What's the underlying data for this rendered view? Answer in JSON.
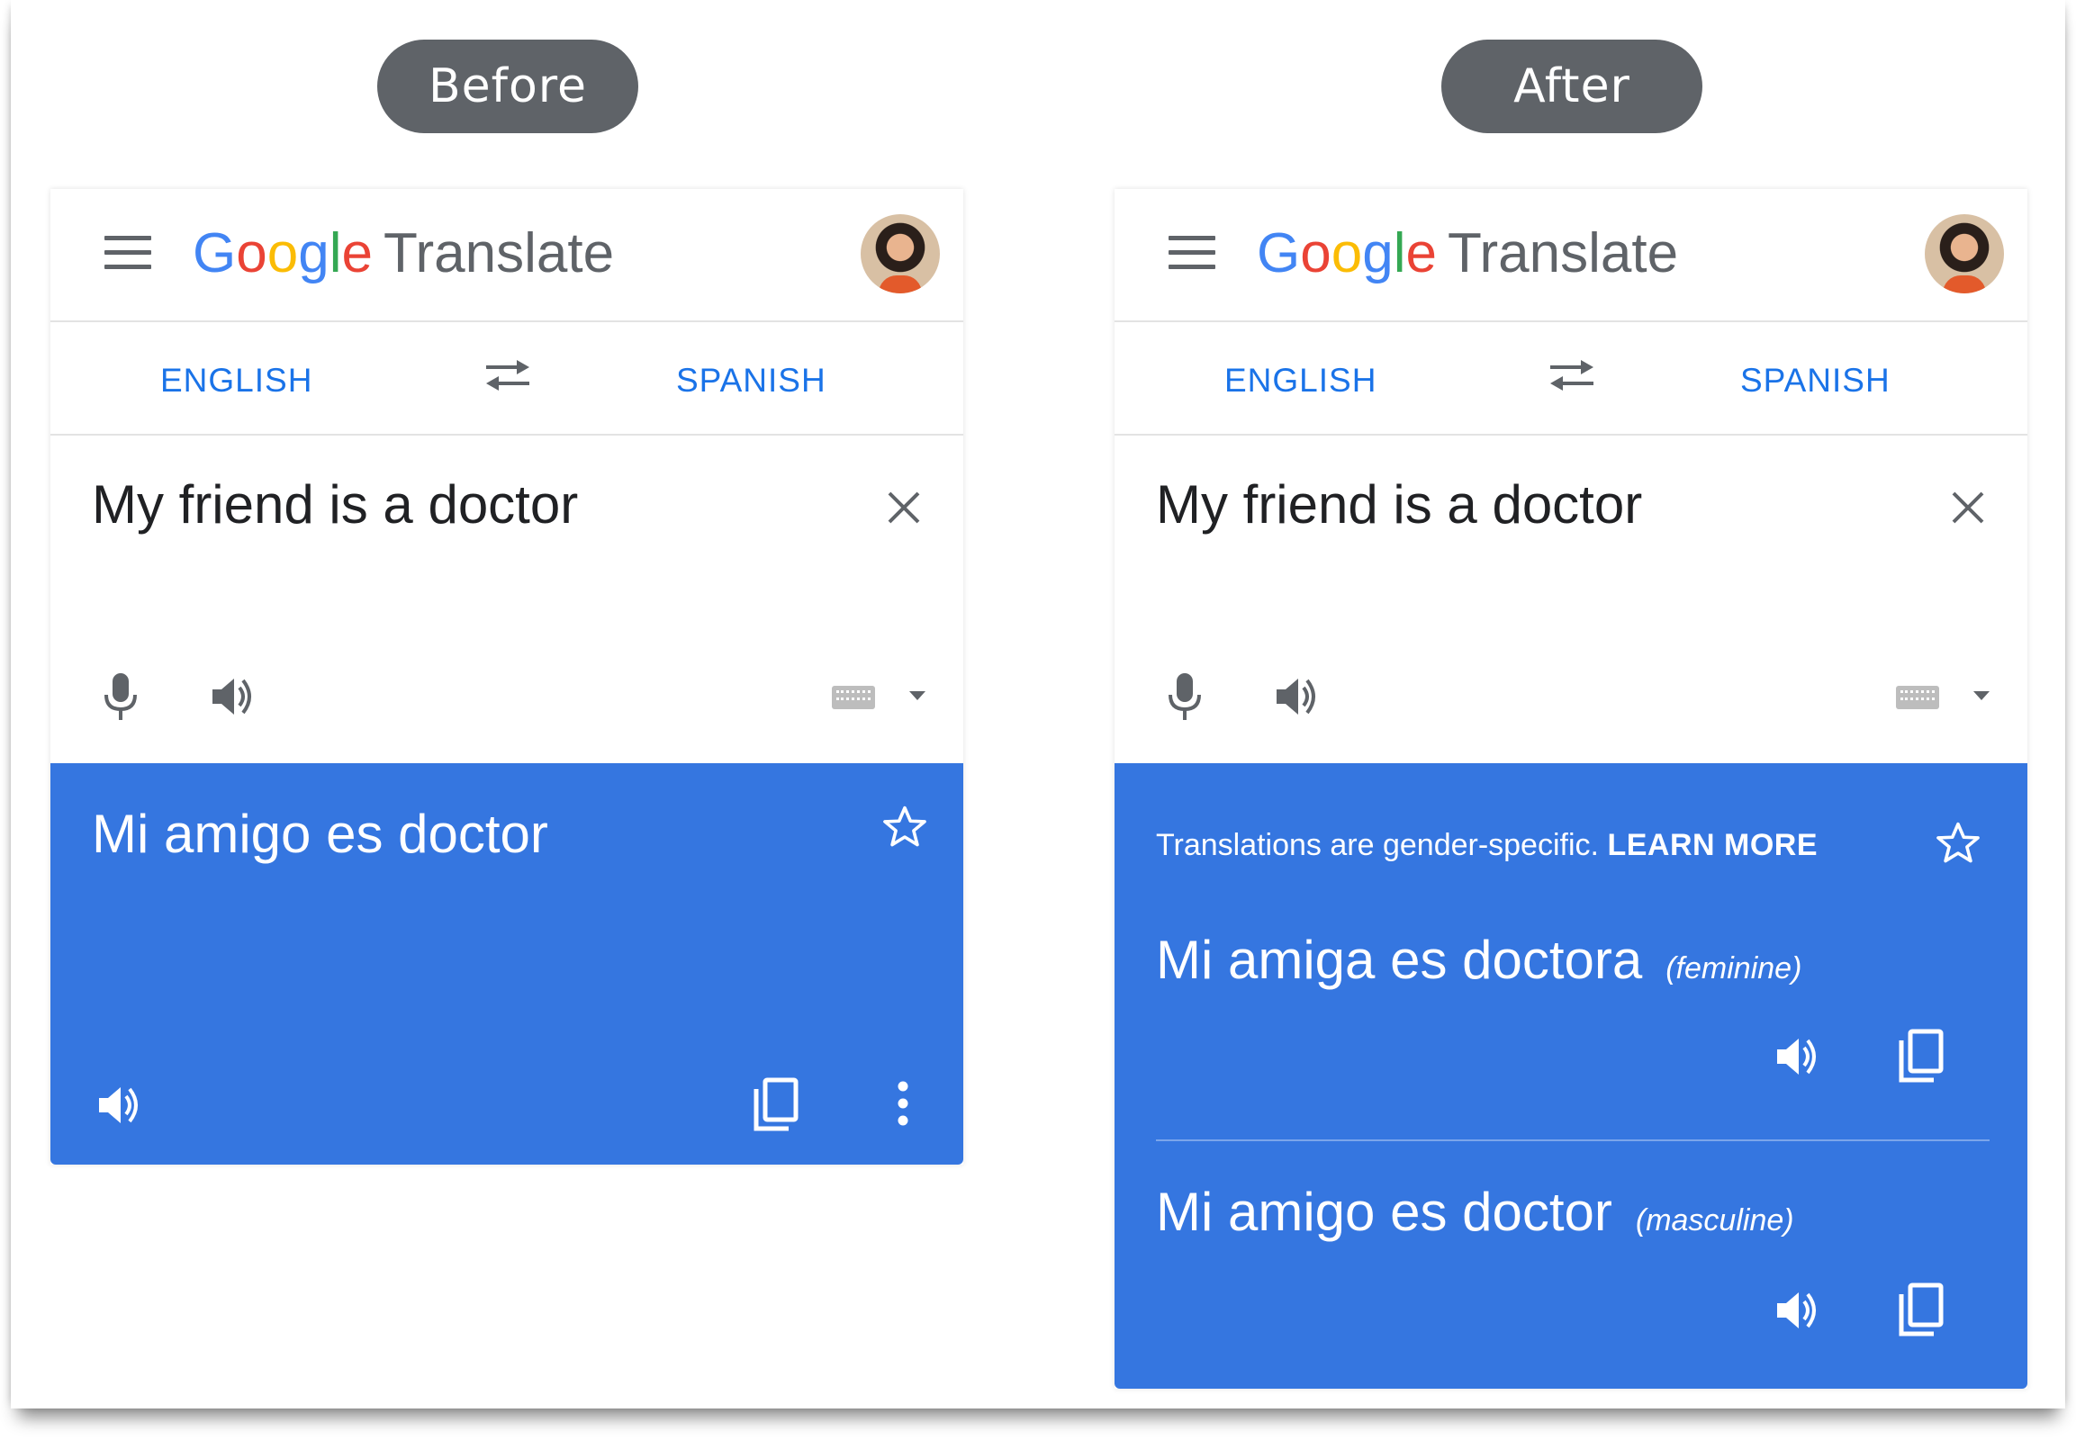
{
  "labels": {
    "before": "Before",
    "after": "After"
  },
  "app": {
    "logo": {
      "g1": "G",
      "o1": "o",
      "o2": "o",
      "g2": "g",
      "l": "l",
      "e": "e",
      "word": "Translate"
    },
    "colors": {
      "blue": "#4285F4",
      "red": "#EA4335",
      "yellow": "#FBBC05",
      "green": "#34A853",
      "accent": "#1a73e8",
      "output_bg": "#3576e0"
    }
  },
  "before": {
    "source_lang": "ENGLISH",
    "target_lang": "SPANISH",
    "input_text": "My friend is a doctor",
    "translation": "Mi amigo es doctor"
  },
  "after": {
    "source_lang": "ENGLISH",
    "target_lang": "SPANISH",
    "input_text": "My friend is a doctor",
    "note": "Translations are gender-specific.",
    "learn_more": "LEARN MORE",
    "translations": [
      {
        "text": "Mi amiga es doctora",
        "tag": "(feminine)"
      },
      {
        "text": "Mi amigo es doctor",
        "tag": "(masculine)"
      }
    ]
  },
  "icons": [
    "menu-icon",
    "swap-icon",
    "close-icon",
    "mic-icon",
    "speaker-icon",
    "keyboard-icon",
    "star-icon",
    "copy-icon",
    "more-icon"
  ]
}
